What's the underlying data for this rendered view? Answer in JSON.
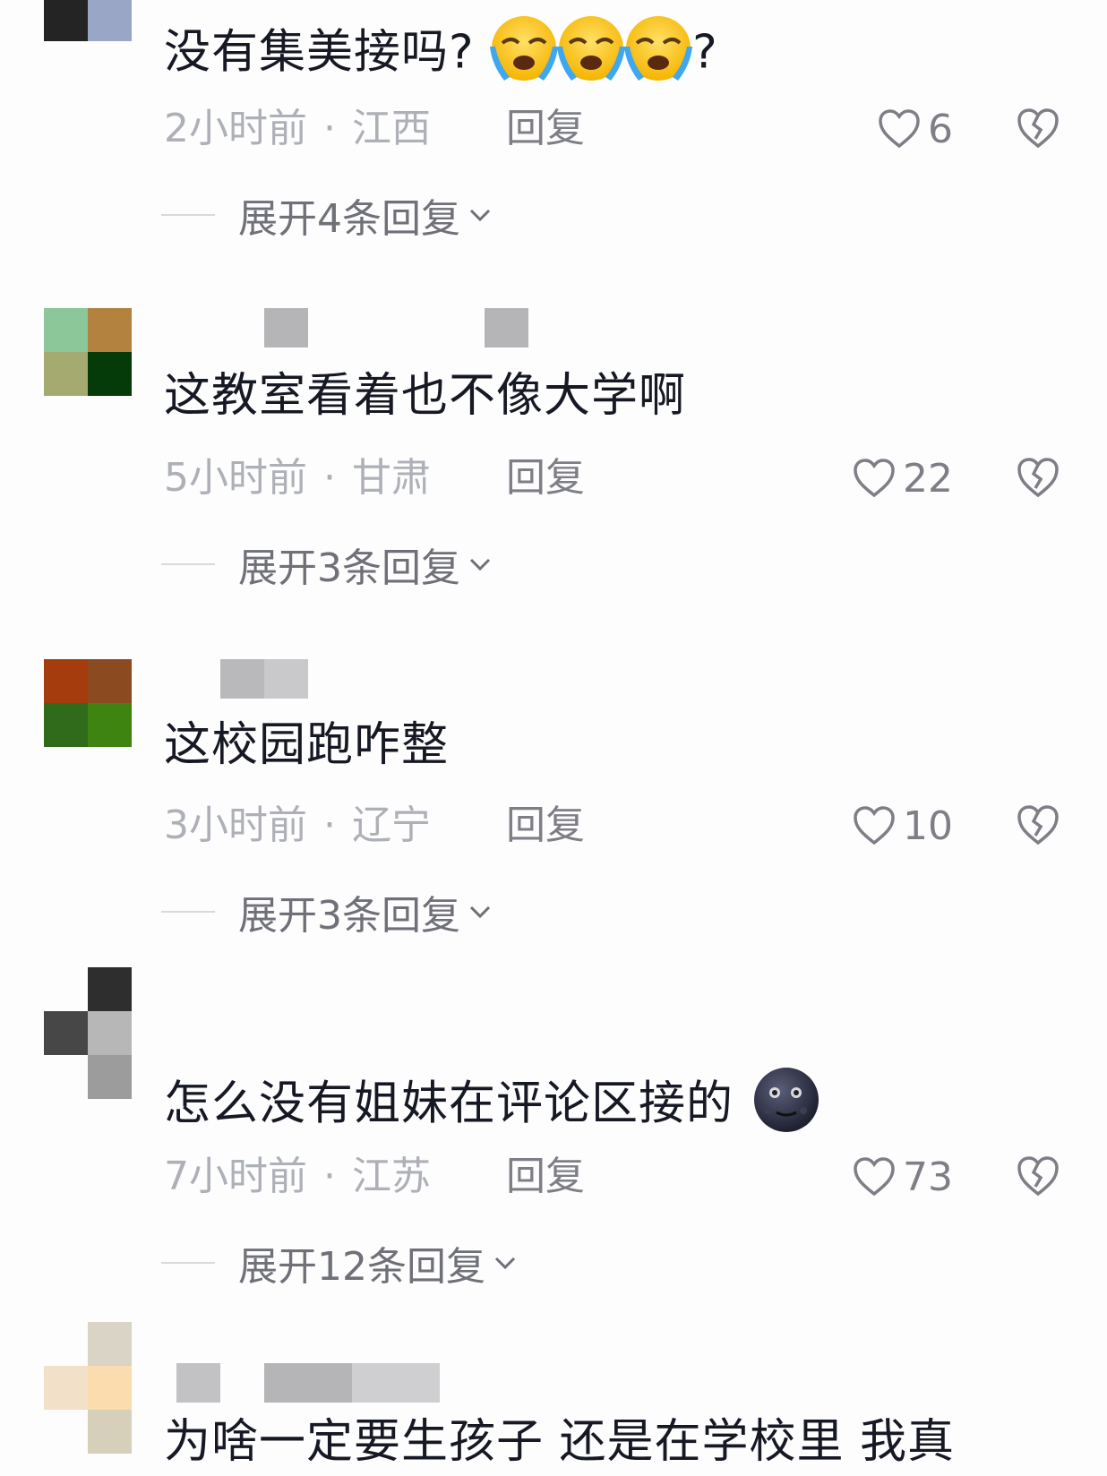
{
  "comments": [
    {
      "text": "没有集美接吗?",
      "text_suffix": "?",
      "emoji": "crying-face-icon",
      "time": "2小时前",
      "location": "江西",
      "reply_label": "回复",
      "likes": "6",
      "expand_label": "展开4条回复"
    },
    {
      "text": "这教室看着也不像大学啊",
      "time": "5小时前",
      "location": "甘肃",
      "reply_label": "回复",
      "likes": "22",
      "expand_label": "展开3条回复"
    },
    {
      "text": "这校园跑咋整",
      "time": "3小时前",
      "location": "辽宁",
      "reply_label": "回复",
      "likes": "10",
      "expand_label": "展开3条回复"
    },
    {
      "text": "怎么没有姐妹在评论区接的",
      "emoji": "new-moon-face-icon",
      "time": "7小时前",
      "location": "江苏",
      "reply_label": "回复",
      "likes": "73",
      "expand_label": "展开12条回复"
    },
    {
      "text": "为啥一定要生孩子 还是在学校里 我真"
    }
  ],
  "colors": {
    "primary_text": "#161823",
    "meta_text": "#aeb0b7",
    "action_text": "#7e7f86",
    "background": "#fdfdfd"
  }
}
